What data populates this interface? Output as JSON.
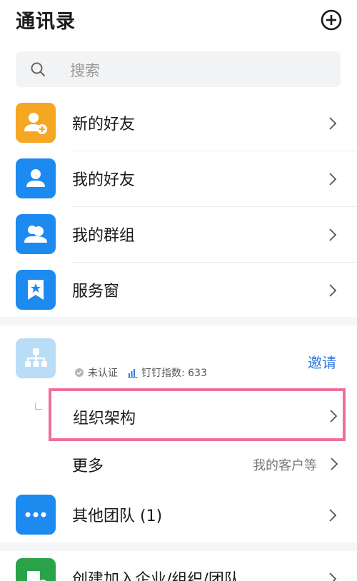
{
  "header": {
    "title": "通讯录",
    "add_icon": "plus-circle-icon"
  },
  "search": {
    "placeholder": "搜索",
    "icon": "search-icon"
  },
  "contacts": [
    {
      "label": "新的好友",
      "color": "#f5a623",
      "icon": "new-friend-icon"
    },
    {
      "label": "我的好友",
      "color": "#1d8af0",
      "icon": "person-icon"
    },
    {
      "label": "我的群组",
      "color": "#1d8af0",
      "icon": "group-icon"
    },
    {
      "label": "服务窗",
      "color": "#1d8af0",
      "icon": "bookmark-star-icon"
    }
  ],
  "org": {
    "invite_label": "邀请",
    "status_label": "未认证",
    "index_label": "钉钉指数: 633",
    "structure_label": "组织架构",
    "more_label": "更多",
    "more_sub": "我的客户等"
  },
  "other_teams": {
    "label": "其他团队 (1)",
    "color": "#1d8af0"
  },
  "create_join": {
    "label": "创建加入企业/组织/团队",
    "color": "#2aa24a"
  },
  "colors": {
    "accent": "#2e7ae0",
    "highlight_border": "#ef6f9a"
  }
}
